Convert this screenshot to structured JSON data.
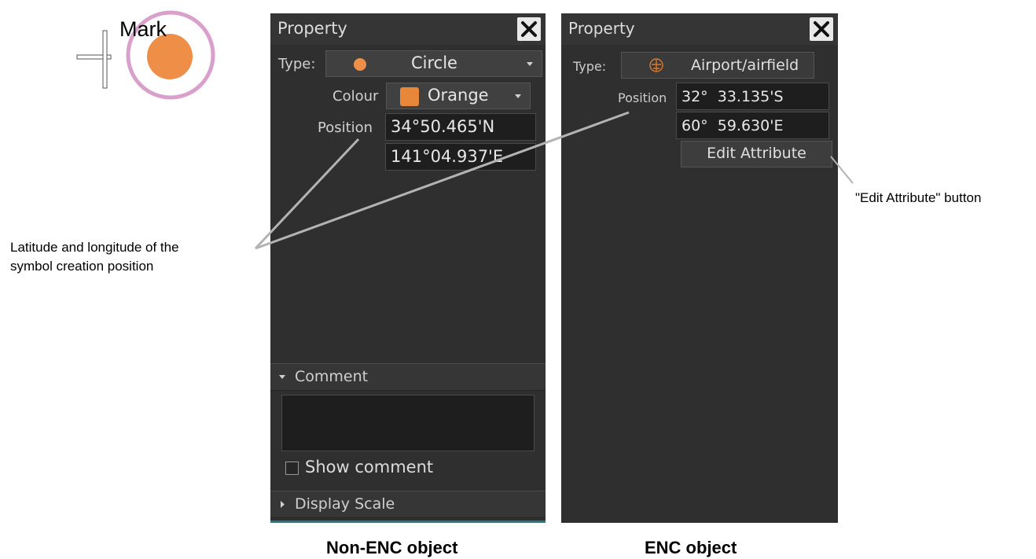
{
  "mark": {
    "label": "Mark"
  },
  "left_panel": {
    "title": "Property",
    "type_label": "Type:",
    "type_value": "Circle",
    "colour_label": "Colour",
    "colour_value": "Orange",
    "colour_swatch": "#e8873a",
    "position_label": "Position",
    "latitude": "34°50.465'N",
    "longitude": "141°04.937'E",
    "comment_header": "Comment",
    "comment_text": "",
    "show_comment_label": "Show comment",
    "show_comment_checked": false,
    "display_scale_header": "Display Scale"
  },
  "right_panel": {
    "title": "Property",
    "type_label": "Type:",
    "type_value": "Airport/airfield",
    "type_icon": "airport-icon",
    "position_label": "Position",
    "latitude": "32°  33.135'S",
    "longitude": "60°  59.630'E",
    "edit_attribute_label": "Edit Attribute"
  },
  "annotations": {
    "latlon_note_line1": "Latitude and longitude of the",
    "latlon_note_line2": "symbol creation position",
    "edit_attribute_note": "\"Edit Attribute\" button"
  },
  "captions": {
    "left": "Non-ENC object",
    "right": "ENC object"
  },
  "colors": {
    "panel_bg": "#2f2f2f",
    "mark_circle_fill": "#ef8f47",
    "mark_ring": "#d9a0cc",
    "airport_icon": "#d97a2e"
  }
}
